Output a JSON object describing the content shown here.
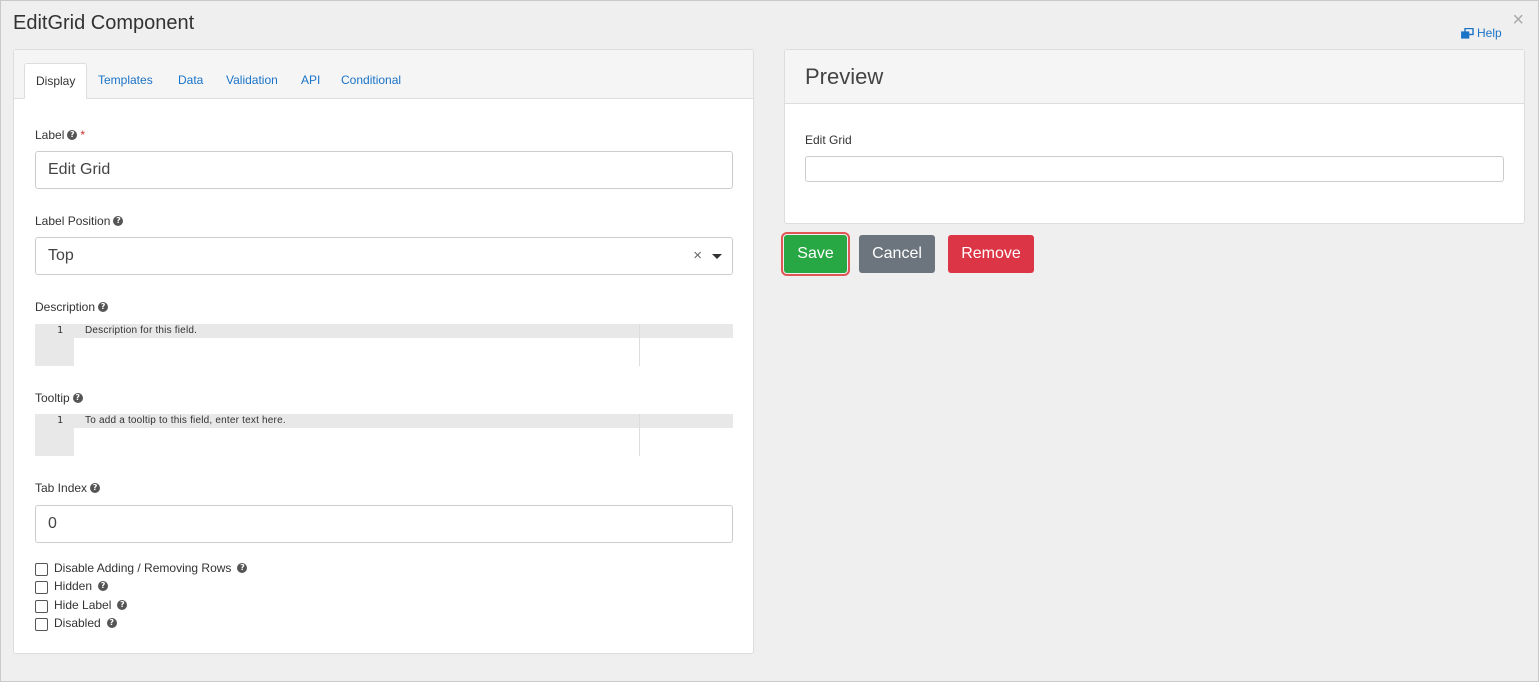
{
  "modal": {
    "title": "EditGrid Component",
    "close_symbol": "×",
    "help_label": "Help"
  },
  "tabs": [
    {
      "label": "Display",
      "active": true
    },
    {
      "label": "Templates"
    },
    {
      "label": "Data"
    },
    {
      "label": "Validation"
    },
    {
      "label": "API"
    },
    {
      "label": "Conditional"
    }
  ],
  "form": {
    "label": {
      "title": "Label",
      "required_mark": "*",
      "value": "Edit Grid"
    },
    "label_position": {
      "title": "Label Position",
      "value": "Top",
      "clear_symbol": "×"
    },
    "description": {
      "title": "Description",
      "line_number": "1",
      "placeholder": "Description for this field."
    },
    "tooltip": {
      "title": "Tooltip",
      "line_number": "1",
      "placeholder": "To add a tooltip to this field, enter text here."
    },
    "tab_index": {
      "title": "Tab Index",
      "value": "0"
    },
    "checkboxes": [
      {
        "label": "Disable Adding / Removing Rows",
        "checked": false
      },
      {
        "label": "Hidden",
        "checked": false
      },
      {
        "label": "Hide Label",
        "checked": false
      },
      {
        "label": "Disabled",
        "checked": false
      }
    ],
    "help_symbol": "?"
  },
  "preview": {
    "title": "Preview",
    "field_label": "Edit Grid"
  },
  "buttons": {
    "save": "Save",
    "cancel": "Cancel",
    "remove": "Remove"
  },
  "colors": {
    "save": "#28a745",
    "cancel": "#6c757d",
    "remove": "#dc3545",
    "link": "#1a73c7"
  },
  "icons": {
    "help": "external-window-icon",
    "close": "close-icon",
    "question": "question-circle-icon",
    "caret": "caret-down-icon"
  }
}
